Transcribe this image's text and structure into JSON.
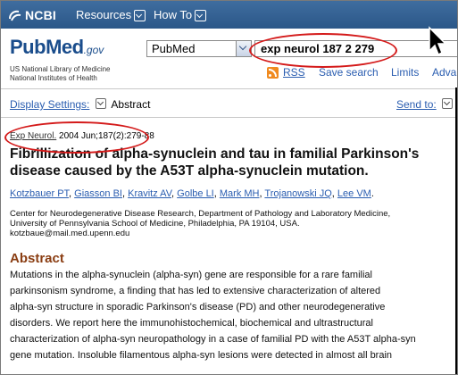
{
  "topbar": {
    "logo_text": "NCBI",
    "resources_label": "Resources",
    "howto_label": "How To"
  },
  "header": {
    "logo_pub": "Pub",
    "logo_med": "Med",
    "logo_gov": ".gov",
    "nlm_line1": "US National Library of Medicine",
    "nlm_line2": "National Institutes of Health",
    "database_selected": "PubMed",
    "search_value": "exp neurol 187 2 279",
    "links": {
      "rss": "RSS",
      "save_search": "Save search",
      "limits": "Limits",
      "advanced": "Adva"
    }
  },
  "display": {
    "settings_label": "Display Settings:",
    "format": "Abstract",
    "send_to": "Send to:"
  },
  "article": {
    "journal": "Exp Neurol.",
    "citation_rest": " 2004 Jun;187(2):279-88",
    "title": "Fibrillization of alpha-synuclein and tau in familial Parkinson's disease caused by the A53T alpha-synuclein mutation.",
    "authors": [
      "Kotzbauer PT",
      "Giasson BI",
      "Kravitz AV",
      "Golbe LI",
      "Mark MH",
      "Trojanowski JQ",
      "Lee VM"
    ],
    "affiliation_line1": "Center for Neurodegenerative Disease Research, Department of Pathology and Laboratory Medicine,",
    "affiliation_line2": "University of Pennsylvania School of Medicine, Philadelphia, PA 19104, USA.",
    "email": "kotzbaue@mail.med.upenn.edu",
    "abstract_heading": "Abstract",
    "abstract_lines": [
      "Mutations in the alpha-synuclein (alpha-syn) gene are responsible for a rare familial",
      "parkinsonism syndrome, a finding that has led to extensive characterization of altered",
      "alpha-syn structure in sporadic Parkinson's disease (PD) and other neurodegenerative",
      "disorders. We report here the immunohistochemical, biochemical and ultrastructural",
      "characterization of alpha-syn neuropathology in a case of familial PD with the A53T alpha-syn",
      "gene mutation. Insoluble filamentous alpha-syn lesions were detected in almost all brain"
    ]
  },
  "colors": {
    "ncbi_bar": "#2b5788",
    "link": "#2a5db0",
    "abstract_heading": "#8a3d12",
    "annotation": "#d41a1a"
  }
}
